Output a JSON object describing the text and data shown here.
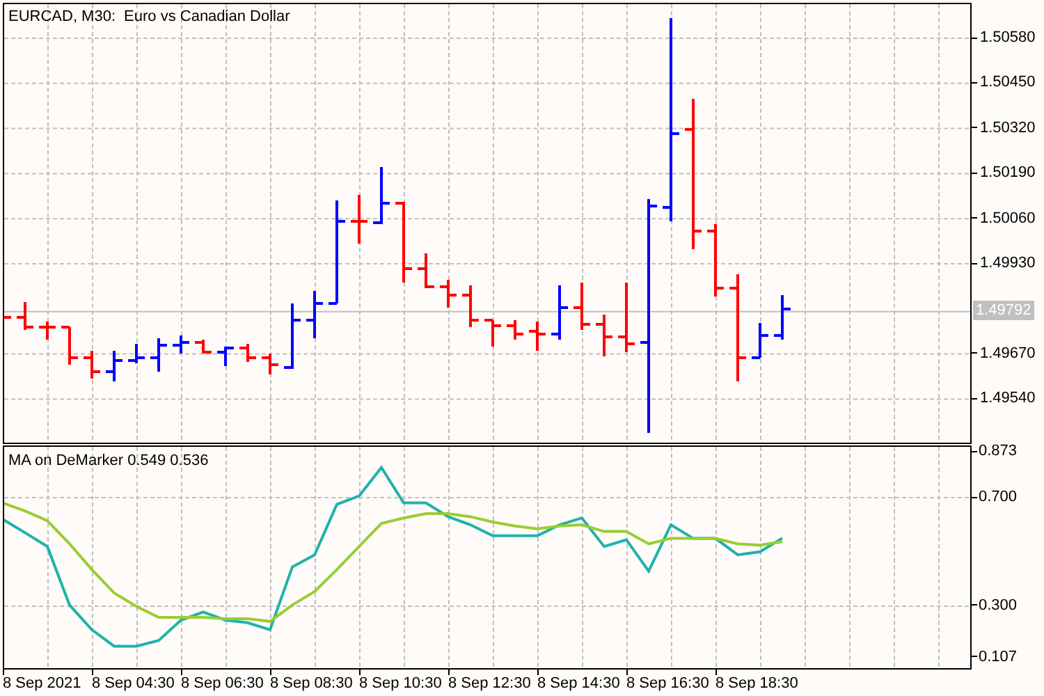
{
  "price_chart": {
    "symbol": "EURCAD, M30:",
    "description": "Euro vs Canadian Dollar",
    "price_labels": [
      "1.50580",
      "1.50450",
      "1.50320",
      "1.50190",
      "1.50060",
      "1.49930",
      "1.49670",
      "1.49540"
    ],
    "current_price": "1.49792"
  },
  "indicator": {
    "title": "MA on DeMarker 0.549 0.536",
    "chart_data": {
      "type": "line",
      "grid": true,
      "series": [
        {
          "color": "#20b2aa",
          "values": [
            0.619,
            0.569,
            0.518,
            0.3,
            0.208,
            0.147,
            0.147,
            0.168,
            0.244,
            0.274,
            0.244,
            0.234,
            0.208,
            0.442,
            0.487,
            0.675,
            0.706,
            0.812,
            0.68,
            0.68,
            0.629,
            0.599,
            0.558,
            0.558,
            0.558,
            0.599,
            0.624,
            0.518,
            0.543,
            0.426,
            0.599,
            0.548,
            0.548,
            0.487,
            0.498,
            0.549
          ]
        },
        {
          "color": "#9acd32",
          "values": [
            0.68,
            0.65,
            0.614,
            0.528,
            0.432,
            0.345,
            0.295,
            0.254,
            0.254,
            0.254,
            0.249,
            0.249,
            0.239,
            0.3,
            0.35,
            0.432,
            0.518,
            0.604,
            0.624,
            0.64,
            0.64,
            0.629,
            0.609,
            0.594,
            0.584,
            0.594,
            0.599,
            0.574,
            0.574,
            0.528,
            0.548,
            0.548,
            0.548,
            0.528,
            0.523,
            0.536
          ]
        }
      ],
      "ylim": [
        0.065,
        0.889
      ],
      "yticks": [
        {
          "value": 0.873,
          "label": "0.873"
        },
        {
          "value": 0.7,
          "label": "0.700"
        },
        {
          "value": 0.3,
          "label": "0.300"
        },
        {
          "value": 0.107,
          "label": "0.107"
        }
      ]
    }
  },
  "time_axis": {
    "labels": [
      "8 Sep 2021",
      "8 Sep 04:30",
      "8 Sep 06:30",
      "8 Sep 08:30",
      "8 Sep 10:30",
      "8 Sep 12:30",
      "8 Sep 14:30",
      "8 Sep 16:30",
      "8 Sep 18:30"
    ]
  }
}
